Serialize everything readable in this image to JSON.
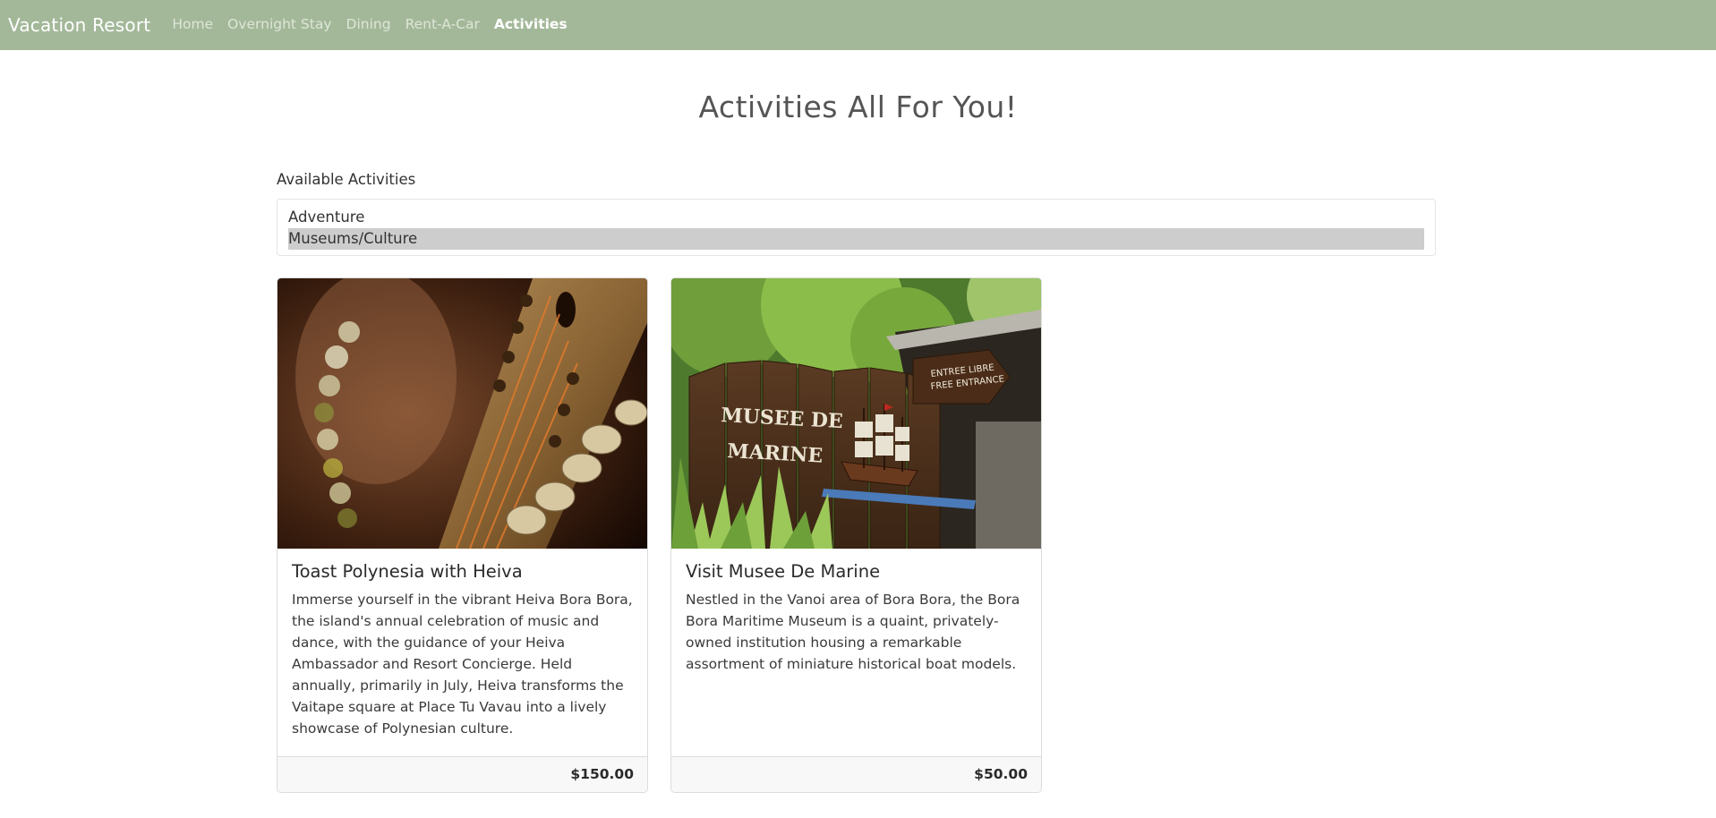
{
  "navbar": {
    "brand": "Vacation Resort",
    "links": [
      {
        "label": "Home"
      },
      {
        "label": "Overnight Stay"
      },
      {
        "label": "Dining"
      },
      {
        "label": "Rent-A-Car"
      },
      {
        "label": "Activities",
        "active": true
      }
    ],
    "background_color": "#a3b899"
  },
  "page": {
    "title": "Activities All For You!"
  },
  "activities_select": {
    "label": "Available Activities",
    "visible_options": [
      "Adventure",
      "Museums/Culture"
    ],
    "selected": "Museums/Culture"
  },
  "cards": [
    {
      "title": "Toast Polynesia with Heiva",
      "description": "Immerse yourself in the vibrant Heiva Bora Bora, the island's annual celebration of music and dance, with the guidance of your Heiva Ambassador and Resort Concierge. Held annually, primarily in July, Heiva transforms the Vaitape square at Place Tu Vavau into a lively showcase of Polynesian culture.",
      "price": "$150.00",
      "image": "ukulele-headstock-photo"
    },
    {
      "title": "Visit Musee De Marine",
      "description": "Nestled in the Vanoi area of Bora Bora, the Bora Bora Maritime Museum is a quaint, privately-owned institution housing a remarkable assortment of miniature historical boat models.",
      "price": "$50.00",
      "image": "museum-sign-photo",
      "sign_text": [
        "MUSEE DE",
        "MARINE"
      ],
      "arrow_sign_text": [
        "ENTREE LIBRE",
        "FREE ENTRANCE"
      ]
    }
  ]
}
